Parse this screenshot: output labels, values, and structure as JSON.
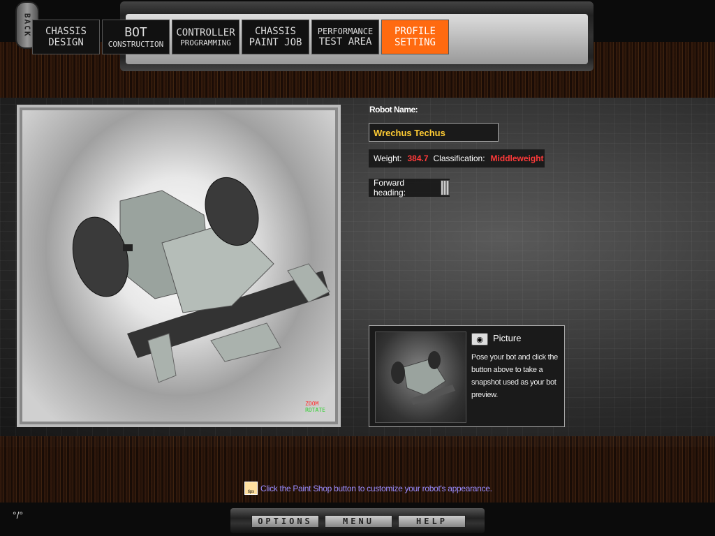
{
  "back_label": "BACK",
  "nav": {
    "tabs": [
      {
        "line1": "CHASSIS",
        "line2": "DESIGN"
      },
      {
        "line1": "BOT",
        "line2": "CONSTRUCTION"
      },
      {
        "line1": "CONTROLLER",
        "line2": "PROGRAMMING"
      },
      {
        "line1": "CHASSIS",
        "line2": "PAINT JOB"
      },
      {
        "line1": "PERFORMANCE",
        "line2": "TEST AREA"
      },
      {
        "line1": "PROFILE",
        "line2": "SETTING"
      }
    ],
    "active_index": 5
  },
  "viewport": {
    "zoom_label": "ZOOM",
    "rotate_label": "ROTATE"
  },
  "profile": {
    "name_label": "Robot Name:",
    "name_value": "Wrechus Techus",
    "weight_label": "Weight:",
    "weight_value": "384.7",
    "class_label": "Classification:",
    "class_value": "Middleweight",
    "heading_label": "Forward heading:"
  },
  "picture": {
    "title": "Picture",
    "text": "Pose your bot and click the button above to take a snapshot used as your bot preview."
  },
  "tips": {
    "icon_label": "tips",
    "text": "Click the Paint Shop button to customize your robot's appearance."
  },
  "bottom": {
    "options": "OPTIONS",
    "menu": "MENU",
    "help": "HELP"
  },
  "colors": {
    "accent": "#ff6a10",
    "name": "#ffcc33",
    "stat": "#ff3a3a",
    "tips": "#9a8cff"
  }
}
